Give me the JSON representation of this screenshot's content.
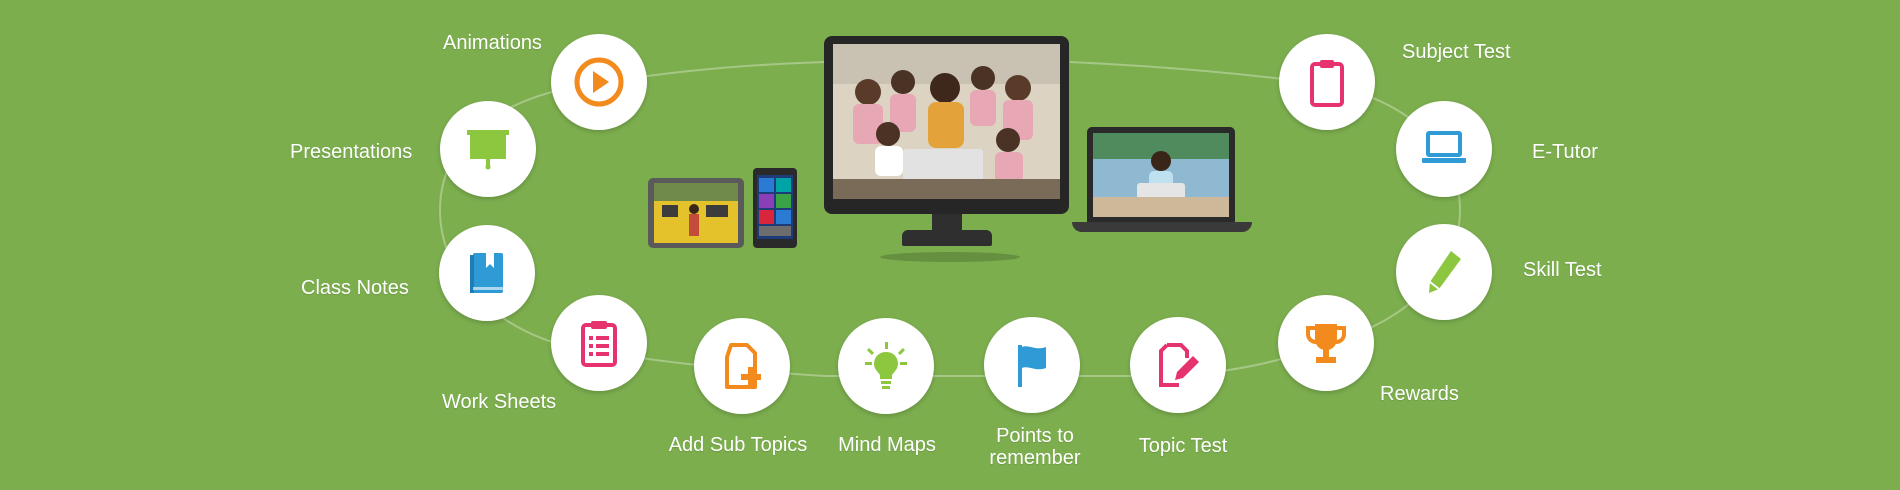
{
  "features": {
    "animations": "Animations",
    "presentations": "Presentations",
    "class_notes": "Class Notes",
    "work_sheets": "Work Sheets",
    "add_sub_topics": "Add Sub Topics",
    "mind_maps": "Mind Maps",
    "points_to_remember_line1": "Points to",
    "points_to_remember_line2": "remember",
    "topic_test": "Topic Test",
    "rewards": "Rewards",
    "skill_test": "Skill Test",
    "e_tutor": "E-Tutor",
    "subject_test": "Subject Test"
  },
  "icons": {
    "animations": "play-icon",
    "presentations": "projector-screen-icon",
    "class_notes": "notebook-icon",
    "work_sheets": "clipboard-list-icon",
    "add_sub_topics": "document-plus-icon",
    "mind_maps": "lightbulb-icon",
    "points_to_remember": "flag-icon",
    "topic_test": "edit-document-icon",
    "rewards": "trophy-icon",
    "skill_test": "pencil-icon",
    "e_tutor": "laptop-icon",
    "subject_test": "clipboard-icon"
  },
  "colors": {
    "background": "#7cae4e",
    "orange": "#f28a1e",
    "green": "#8dc63f",
    "blue": "#2e9bd6",
    "pink": "#e6336d"
  }
}
